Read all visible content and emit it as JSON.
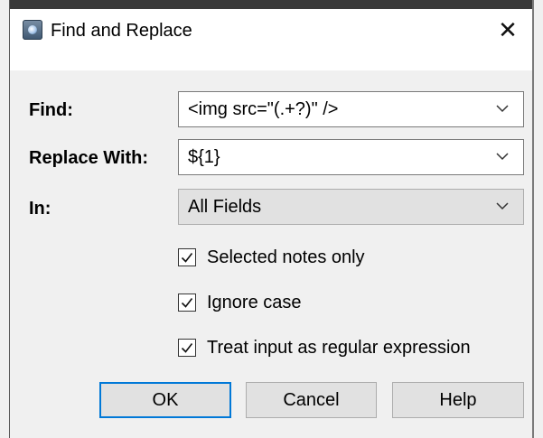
{
  "dialog": {
    "title": "Find and Replace",
    "close_glyph": "✕"
  },
  "fields": {
    "find": {
      "label": "Find:",
      "value": "<img src=\"(.+?)\" />"
    },
    "replace": {
      "label": "Replace With:",
      "value": "${1}"
    },
    "in": {
      "label": "In:",
      "value": "All Fields"
    }
  },
  "options": [
    {
      "label": "Selected notes only",
      "checked": true
    },
    {
      "label": "Ignore case",
      "checked": true
    },
    {
      "label": "Treat input as regular expression",
      "checked": true
    }
  ],
  "buttons": {
    "ok": "OK",
    "cancel": "Cancel",
    "help": "Help"
  },
  "colors": {
    "accent": "#0078d7",
    "window_bg": "#f0f0f0"
  }
}
